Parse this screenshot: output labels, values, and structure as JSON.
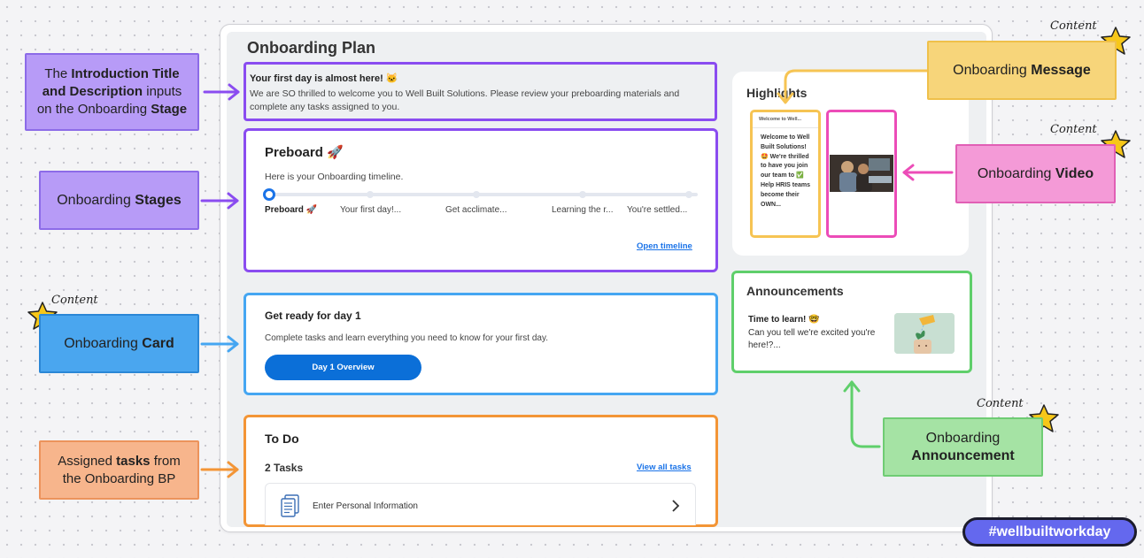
{
  "page": {
    "title": "Onboarding Plan"
  },
  "intro": {
    "title": "Your first day is almost here! 🐱",
    "description": "We are SO thrilled to welcome you to Well Built Solutions. Please review your preboarding materials and complete any tasks assigned to you."
  },
  "stages": {
    "title": "Preboard 🚀",
    "subtitle": "Here is your Onboarding timeline.",
    "items": [
      {
        "label": "Preboard 🚀",
        "active": true
      },
      {
        "label": "Your first day!...",
        "active": false
      },
      {
        "label": "Get acclimate...",
        "active": false
      },
      {
        "label": "Learning the r...",
        "active": false
      },
      {
        "label": "You're settled...",
        "active": false
      }
    ],
    "link": "Open timeline"
  },
  "card": {
    "title": "Get ready for day 1",
    "description": "Complete tasks and learn everything you need to know for your first day.",
    "button": "Day 1 Overview"
  },
  "todo": {
    "title": "To Do",
    "count": "2 Tasks",
    "link": "View all tasks",
    "tasks": [
      {
        "label": "Enter Personal Information",
        "icon": "document-icon"
      }
    ]
  },
  "highlights": {
    "title": "Highlights",
    "message_header": "Welcome to Well...",
    "message_body": "Welcome to Well Built Solutions! 🤩 We're thrilled to have you join our team to ✅ Help HRIS teams become their OWN..."
  },
  "announcements": {
    "title": "Announcements",
    "item_title": "Time to learn! 🤓",
    "item_text": "Can you tell we're excited you're here!?..."
  },
  "callouts": {
    "intro": {
      "pre": "The ",
      "bold1": "Introduction Title and Description",
      "mid": " inputs on the Onboarding ",
      "bold2": "Stage"
    },
    "stages": {
      "pre": "Onboarding ",
      "bold": "Stages"
    },
    "card": {
      "pre": "Onboarding ",
      "bold": "Card"
    },
    "tasks": {
      "pre": "Assigned ",
      "bold": "tasks",
      "post": " from the Onboarding BP"
    },
    "message": {
      "pre": "Onboarding ",
      "bold": "Message"
    },
    "video": {
      "pre": "Onboarding ",
      "bold": "Video"
    },
    "announcement": {
      "pre": "Onboarding",
      "bold": "Announcement"
    }
  },
  "content_tag": "Content",
  "hashtag": "#wellbuiltworkday",
  "colors": {
    "purple": "#8a4cf0",
    "blue": "#45a6f2",
    "orange": "#f39536",
    "yellow": "#f6c453",
    "pink": "#ec4cb8",
    "green": "#5fcf6b",
    "link": "#1a73e8",
    "button": "#0b6fd8",
    "star": "#f7c719"
  }
}
